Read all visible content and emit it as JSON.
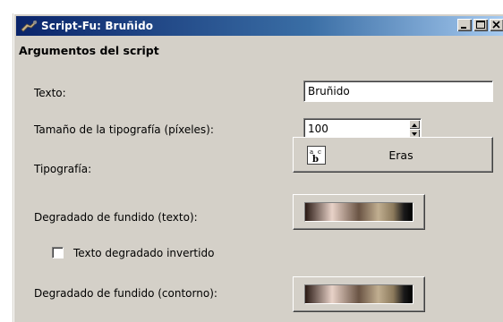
{
  "window": {
    "title": "Script-Fu: Bruñido",
    "buttons": {
      "minimize": "minimize-icon",
      "maximize": "maximize-icon",
      "close": "close-icon"
    }
  },
  "section": {
    "title": "Argumentos del script"
  },
  "fields": {
    "text": {
      "label": "Texto:",
      "value": "Bruñido"
    },
    "font_size": {
      "label": "Tamaño de la tipografía (píxeles):",
      "value": "100"
    },
    "font": {
      "label": "Tipografía:",
      "value": "Eras",
      "icon": "font-icon"
    },
    "blend_text": {
      "label": "Degradado de fundido (texto):",
      "icon": "gradient-preview"
    },
    "inverted": {
      "label": "Texto degradado invertido",
      "checked": false
    },
    "blend_outline": {
      "label": "Degradado de fundido (contorno):",
      "icon": "gradient-preview"
    }
  }
}
